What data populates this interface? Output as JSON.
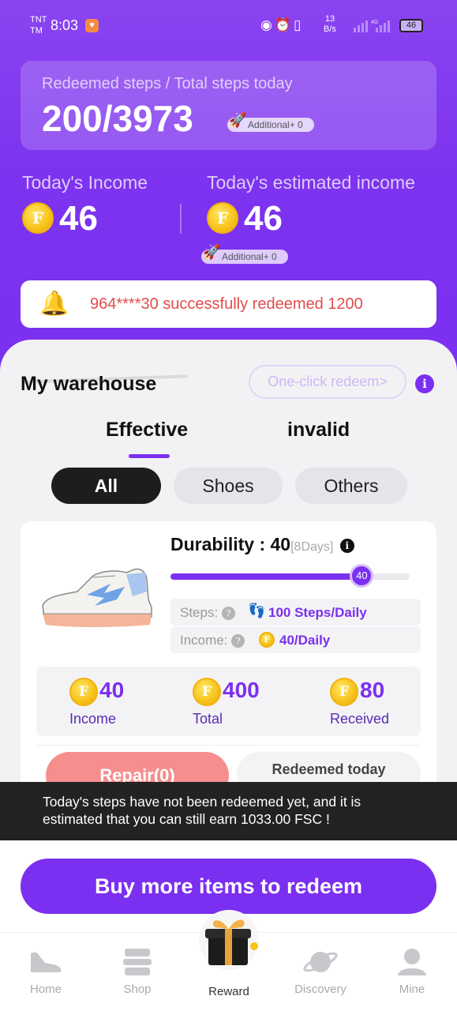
{
  "status_bar": {
    "carrier_top": "TNT",
    "carrier_bottom": "TM",
    "time": "8:03",
    "net_speed_value": "13",
    "net_speed_unit": "B/s",
    "network_type": "4G",
    "battery": "46"
  },
  "steps": {
    "label": "Redeemed steps / Total steps today",
    "value": "200/3973",
    "additional": "Additional+ 0"
  },
  "income": {
    "today_label": "Today's Income",
    "today_value": "46",
    "estimated_label": "Today's estimated income",
    "estimated_value": "46",
    "estimated_additional": "Additional+ 0",
    "coin_symbol": "F"
  },
  "notice": {
    "text": "964****30 successfully redeemed 1200"
  },
  "warehouse": {
    "title": "My warehouse",
    "one_click": "One-click redeem>",
    "info": "i",
    "tabs": [
      "Effective",
      "invalid"
    ],
    "filters": [
      "All",
      "Shoes",
      "Others"
    ]
  },
  "item": {
    "durability_label": "Durability : 40",
    "durability_days": "[8Days]",
    "durability_level": 40,
    "durability_max": 50,
    "knob_value": "40",
    "steps_label": "Steps:",
    "steps_value": "100 Steps/Daily",
    "income_label": "Income:",
    "income_value": "40/Daily",
    "stats": [
      {
        "value": "40",
        "label": "Income"
      },
      {
        "value": "400",
        "label": "Total"
      },
      {
        "value": "80",
        "label": "Received"
      }
    ],
    "repair": "Repair(0)",
    "redeemed_today": "Redeemed today"
  },
  "toast": {
    "line1": "Today's steps have not been redeemed yet, and it is",
    "line2": "estimated that you can still earn 1033.00 FSC !"
  },
  "cta": "Buy more items to redeem",
  "nav": [
    {
      "label": "Home",
      "icon": "shoe-icon"
    },
    {
      "label": "Shop",
      "icon": "shop-icon"
    },
    {
      "label": "Reward",
      "icon": "gift-icon"
    },
    {
      "label": "Discovery",
      "icon": "planet-icon"
    },
    {
      "label": "Mine",
      "icon": "person-icon"
    }
  ],
  "colors": {
    "accent": "#7b2ff0",
    "coin": "#f7c21a",
    "notice_text": "#e34c4c",
    "repair": "#f68e8e"
  }
}
